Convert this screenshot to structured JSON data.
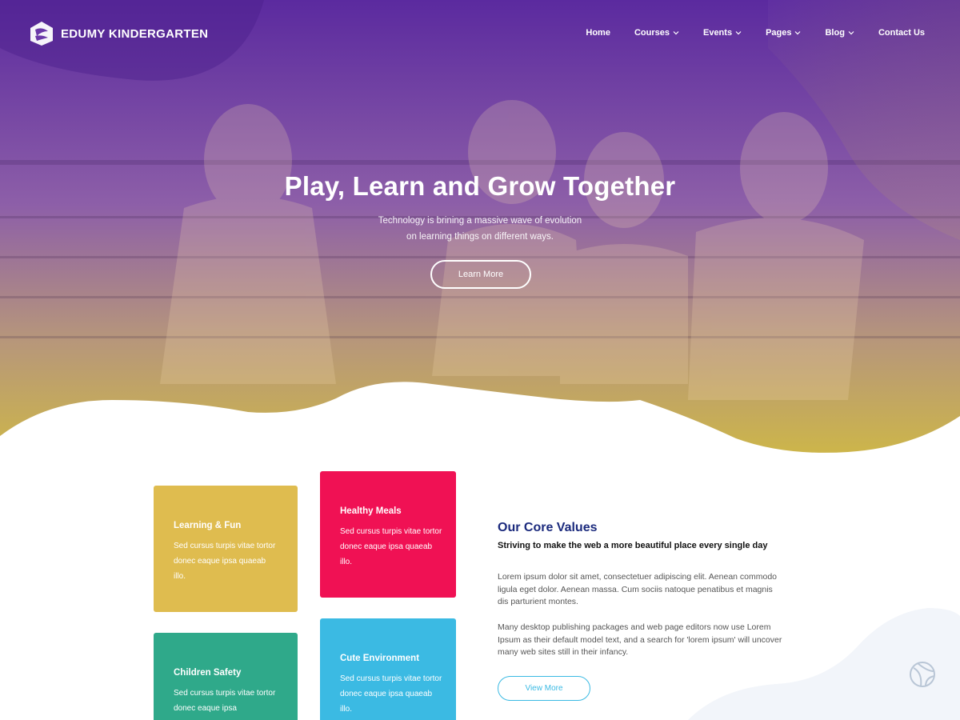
{
  "brand": {
    "logo_icon": "book-leaf-logo-icon",
    "name": "EDUMY KINDERGARTEN"
  },
  "nav": {
    "items": [
      {
        "label": "Home",
        "dropdown": false
      },
      {
        "label": "Courses",
        "dropdown": true
      },
      {
        "label": "Events",
        "dropdown": true
      },
      {
        "label": "Pages",
        "dropdown": true
      },
      {
        "label": "Blog",
        "dropdown": true
      },
      {
        "label": "Contact Us",
        "dropdown": false
      }
    ]
  },
  "hero": {
    "title": "Play, Learn and Grow Together",
    "subtitle_line1": "Technology is brining a massive wave of evolution",
    "subtitle_line2": "on learning things on different ways.",
    "button_label": "Learn More",
    "gradient_top": "#5a2a9e",
    "gradient_bottom": "#c9b24a"
  },
  "features": [
    {
      "title": "Learning & Fun",
      "text": "Sed cursus turpis vitae tortor donec eaque ipsa quaeab illo.",
      "color": "#dfbc4f"
    },
    {
      "title": "Healthy Meals",
      "text": "Sed cursus turpis vitae tortor donec eaque ipsa quaeab illo.",
      "color": "#f01154"
    },
    {
      "title": "Children Safety",
      "text": "Sed cursus turpis vitae tortor donec eaque ipsa",
      "color": "#2fa98a"
    },
    {
      "title": "Cute Environment",
      "text": "Sed cursus turpis vitae tortor donec eaque ipsa quaeab illo.",
      "color": "#3bbae3"
    }
  ],
  "core_values": {
    "title": "Our Core Values",
    "subtitle": "Striving to make the web a more beautiful place every single day",
    "paragraph1": "Lorem ipsum dolor sit amet, consectetuer adipiscing elit. Aenean commodo ligula eget dolor. Aenean massa. Cum sociis natoque penatibus et magnis dis parturient montes.",
    "paragraph2": "Many desktop publishing packages and web page editors now use Lorem Ipsum as their default model text, and a search for 'lorem ipsum' will uncover many web sites still in their infancy.",
    "button_label": "View More",
    "title_color": "#1b2a7d",
    "accent_color": "#3bbae3"
  },
  "decor": {
    "corner_icon": "ball-icon"
  }
}
